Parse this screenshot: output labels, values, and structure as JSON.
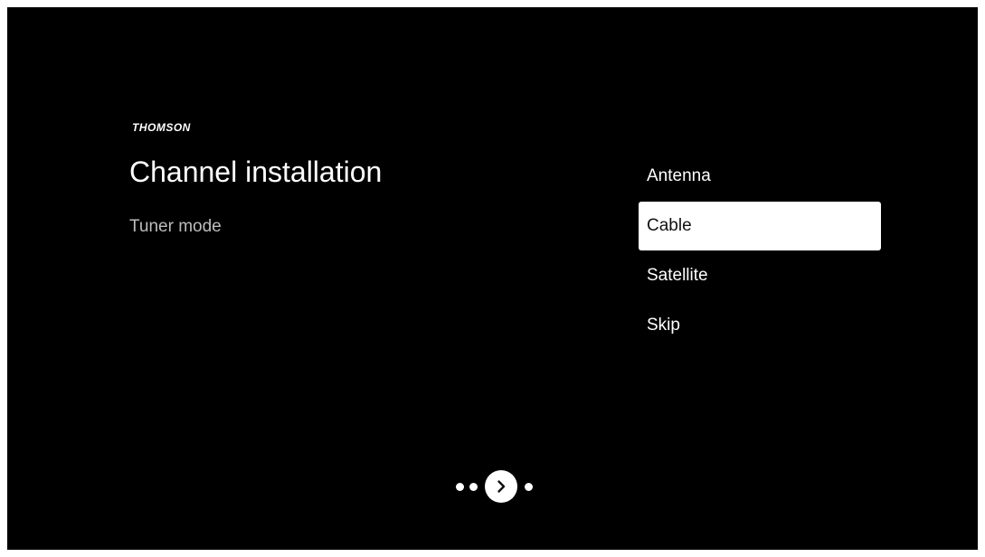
{
  "brand": "THOMSON",
  "title": "Channel installation",
  "subtitle": "Tuner mode",
  "options": [
    {
      "label": "Antenna",
      "selected": false
    },
    {
      "label": "Cable",
      "selected": true
    },
    {
      "label": "Satellite",
      "selected": false
    },
    {
      "label": "Skip",
      "selected": false
    }
  ],
  "pager": {
    "dots_before": 2,
    "dots_after": 1,
    "next_icon": "chevron-right-icon"
  },
  "colors": {
    "background": "#000000",
    "text": "#ffffff",
    "subtitle": "#bdbdbd",
    "selected_bg": "#ffffff",
    "selected_text": "#111111"
  }
}
